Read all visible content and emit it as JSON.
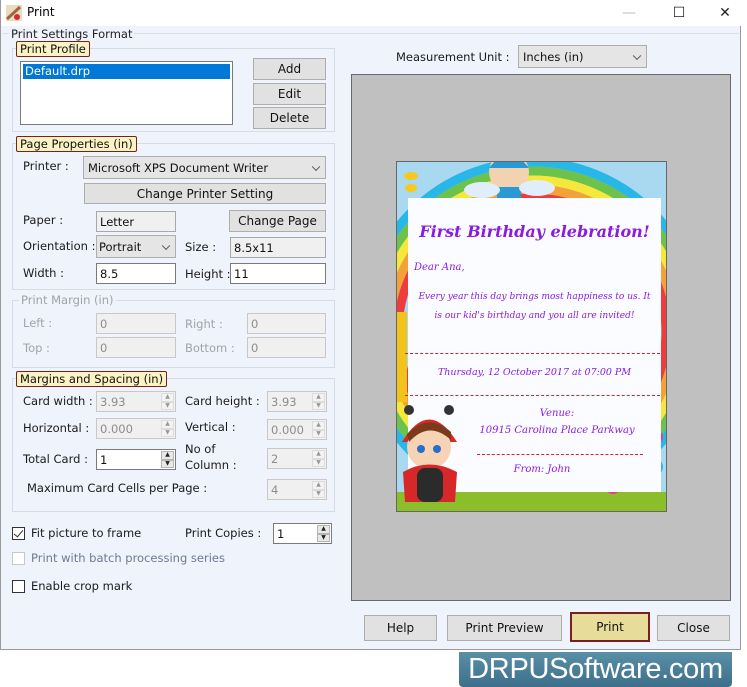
{
  "window": {
    "title": "Print",
    "controls": {
      "minimize": "—",
      "maximize": "☐",
      "close": "✕"
    }
  },
  "print_settings_format": {
    "label": "Print Settings Format",
    "print_profile": {
      "label": "Print Profile",
      "profiles": [
        "Default.drp"
      ],
      "selected": "Default.drp",
      "add_label": "Add",
      "edit_label": "Edit",
      "delete_label": "Delete"
    },
    "page_properties": {
      "label": "Page Properties  (in)",
      "printer_label": "Printer :",
      "printer_value": "Microsoft XPS Document Writer",
      "change_printer_label": "Change Printer Setting",
      "paper_label": "Paper :",
      "paper_value": "Letter",
      "change_page_label": "Change Page",
      "orientation_label": "Orientation :",
      "orientation_value": "Portrait",
      "size_label": "Size :",
      "size_value": "8.5x11",
      "width_label": "Width :",
      "width_value": "8.5",
      "height_label": "Height :",
      "height_value": "11"
    },
    "print_margin": {
      "label": "Print Margin (in)",
      "left_label": "Left :",
      "left_value": "0",
      "right_label": "Right :",
      "right_value": "0",
      "top_label": "Top :",
      "top_value": "0",
      "bottom_label": "Bottom :",
      "bottom_value": "0"
    },
    "margins_spacing": {
      "label": "Margins and Spacing  (in)",
      "card_width_label": "Card width :",
      "card_width_value": "3.93",
      "card_height_label": "Card height :",
      "card_height_value": "3.93",
      "horizontal_label": "Horizontal :",
      "horizontal_value": "0.000",
      "vertical_label": "Vertical :",
      "vertical_value": "0.000",
      "total_card_label": "Total Card :",
      "total_card_value": "1",
      "no_of_column_label_1": "No of",
      "no_of_column_label_2": "Column :",
      "no_of_column_value": "2",
      "max_cells_label": "Maximum Card Cells per Page :",
      "max_cells_value": "4"
    },
    "fit_picture": {
      "label": "Fit picture to frame",
      "checked": true
    },
    "print_copies": {
      "label": "Print Copies :",
      "value": "1"
    },
    "batch_series": {
      "label": "Print with batch processing series",
      "checked": false,
      "disabled": true
    },
    "crop_mark": {
      "label": "Enable crop mark",
      "checked": false
    }
  },
  "measurement": {
    "label": "Measurement Unit :",
    "value": "Inches (in)"
  },
  "card_preview": {
    "title": "First Birthday elebration!",
    "greeting": "Dear Ana,",
    "message_1": "Every year this day brings most happiness to us. It",
    "message_2": "is our kid's birthday and you all are invited!",
    "datetime": "Thursday, 12 October 2017 at 07:00 PM",
    "venue_label": "Venue:",
    "venue_address": "10915 Carolina Place Parkway",
    "from": "From: John"
  },
  "footer": {
    "help_label": "Help",
    "print_preview_label": "Print Preview",
    "print_label": "Print",
    "close_label": "Close"
  },
  "watermark": "DRPUSoftware.com",
  "colors": {
    "accent_legend_bg": "#fbf3c3",
    "accent_legend_border": "#7a1f1f",
    "selection": "#0078d7",
    "print_button": "#e8dc9a",
    "card_text": "#8a1be0",
    "dash_line": "#e02020"
  }
}
